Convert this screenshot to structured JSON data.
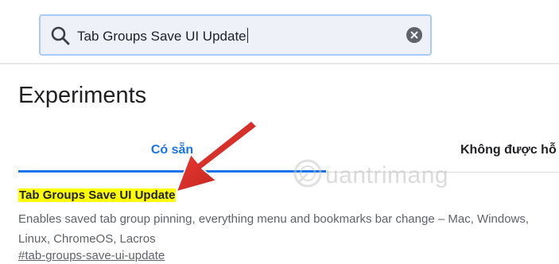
{
  "search": {
    "value": "Tab Groups Save UI Update",
    "icon": "search-icon",
    "clear_icon": "close-icon"
  },
  "page": {
    "title": "Experiments"
  },
  "tabs": [
    {
      "label": "Có sẵn",
      "active": true
    },
    {
      "label": "Không được hỗ"
    }
  ],
  "experiment": {
    "name": "Tab Groups Save UI Update",
    "description": "Enables saved tab group pinning, everything menu and bookmarks bar change – Mac, Windows, Linux, ChromeOS, Lacros",
    "link": "#tab-groups-save-ui-update"
  },
  "watermark": {
    "text": "uantrimang"
  },
  "colors": {
    "accent": "#1a73e8",
    "highlight": "#ffff00",
    "annotation_arrow": "#e53935"
  }
}
